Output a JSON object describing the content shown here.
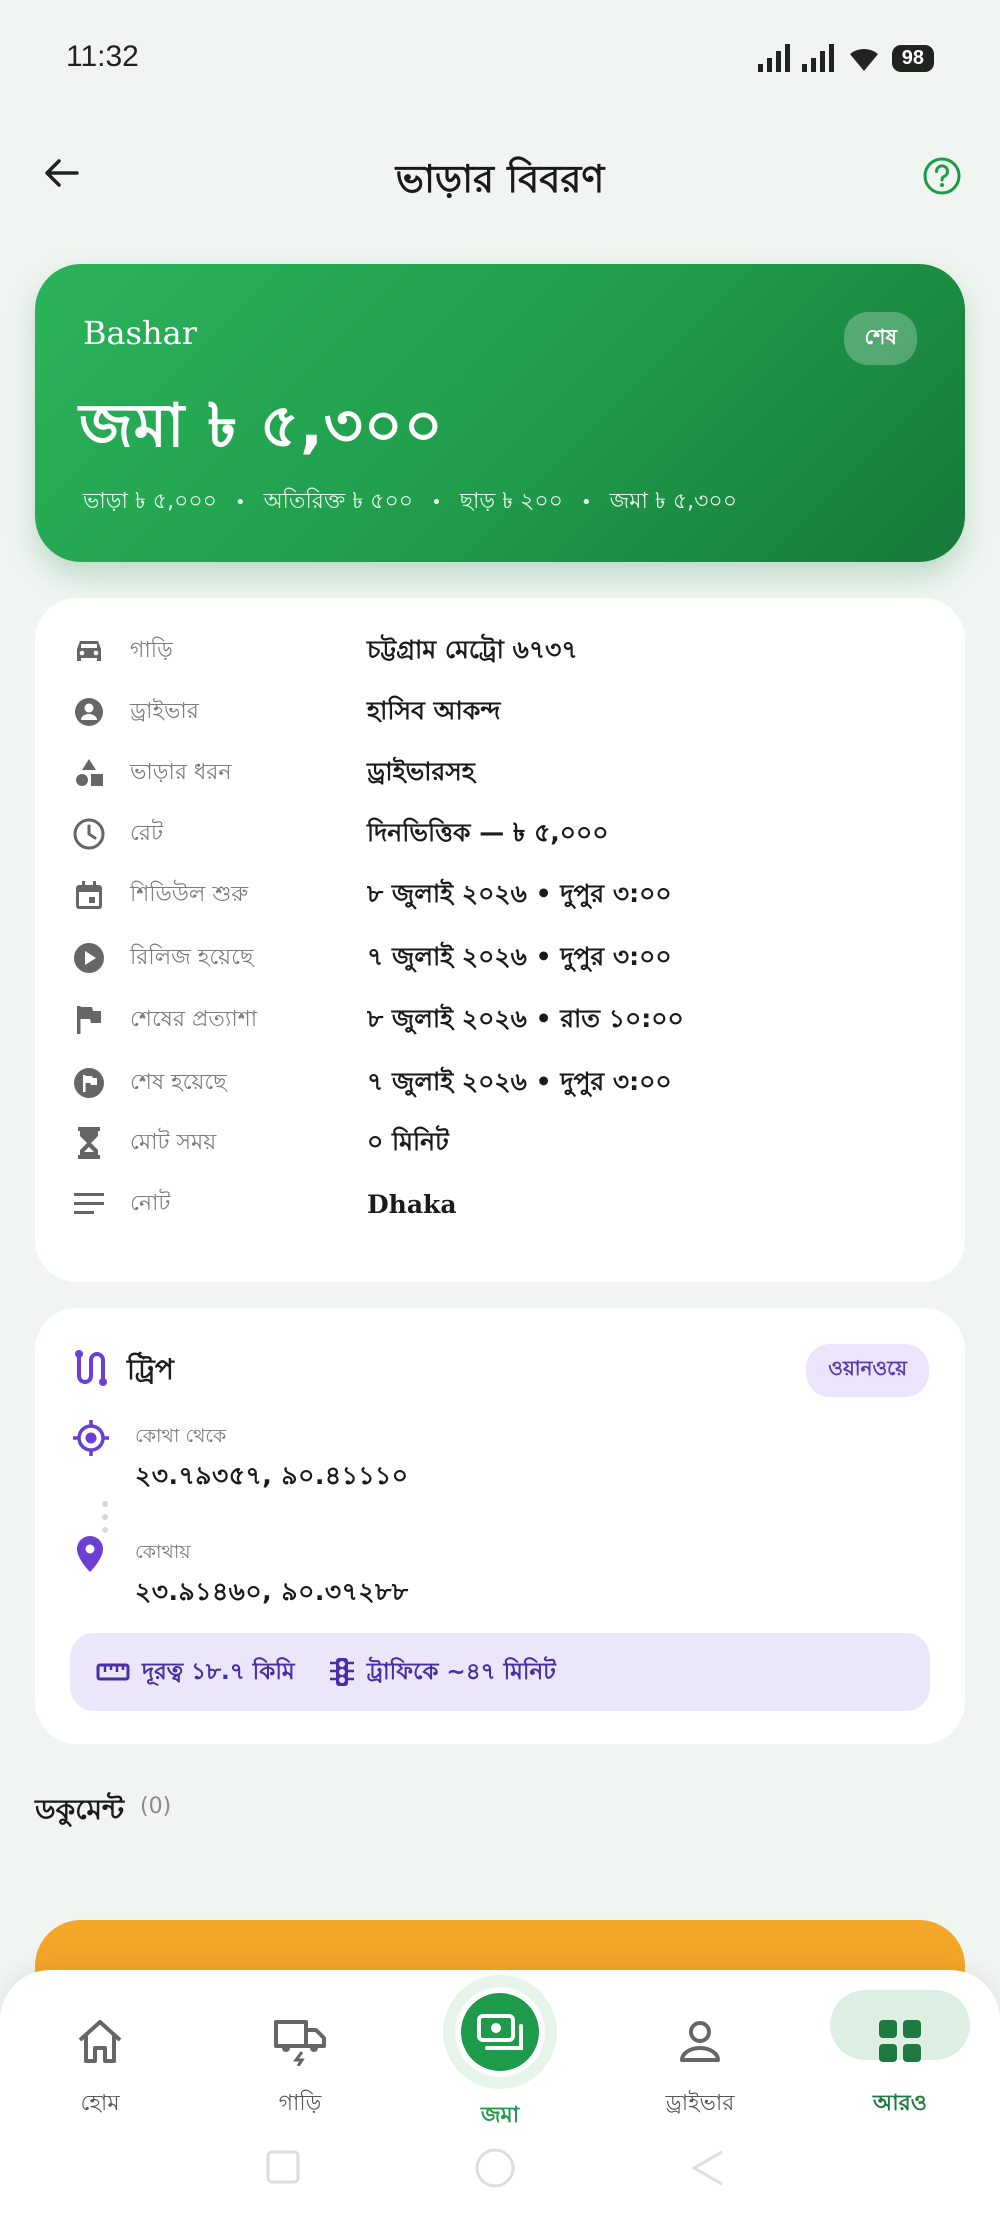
{
  "status_bar": {
    "time": "11:32",
    "battery": "98"
  },
  "header": {
    "title": "ভাড়ার বিবরণ"
  },
  "hero": {
    "name": "Bashar",
    "badge": "শেষ",
    "amount": "জমা ৳ ৫,৩০০",
    "breakdown": [
      "ভাড়া ৳ ৫,০০০",
      "অতিরিক্ত ৳ ৫০০",
      "ছাড় ৳ ২০০",
      "জমা ৳ ৫,৩০০"
    ],
    "separator": "•"
  },
  "details": [
    {
      "icon": "car-icon",
      "label": "গাড়ি",
      "value": "চট্টগ্রাম মেট্রো ৬৭৩৭"
    },
    {
      "icon": "driver-icon",
      "label": "ড্রাইভার",
      "value": "হাসিব আকন্দ"
    },
    {
      "icon": "shapes-icon",
      "label": "ভাড়ার ধরন",
      "value": "ড্রাইভারসহ"
    },
    {
      "icon": "clock-icon",
      "label": "রেট",
      "value": "দিনভিত্তিক — ৳ ৫,০০০"
    },
    {
      "icon": "calendar-icon",
      "label": "শিডিউল শুরু",
      "value": "৮ জুলাই ২০২৬ • দুপুর ৩:০০"
    },
    {
      "icon": "play-icon",
      "label": "রিলিজ হয়েছে",
      "value": "৭ জুলাই ২০২৬ • দুপুর ৩:০০"
    },
    {
      "icon": "flag-icon",
      "label": "শেষের প্রত্যাশা",
      "value": "৮ জুলাই ২০২৬ • রাত ১০:০০"
    },
    {
      "icon": "flag-circle-icon",
      "label": "শেষ হয়েছে",
      "value": "৭ জুলাই ২০২৬ • দুপুর ৩:০০"
    },
    {
      "icon": "hourglass-icon",
      "label": "মোট সময়",
      "value": "০ মিনিট"
    },
    {
      "icon": "notes-icon",
      "label": "নোট",
      "value": "Dhaka"
    }
  ],
  "trip": {
    "title": "ট্রিপ",
    "badge": "ওয়ানওয়ে",
    "from_label": "কোথা থেকে",
    "from_value": "২৩.৭৯৩৫৭, ৯০.৪১১১০",
    "to_label": "কোথায়",
    "to_value": "২৩.৯১৪৬০, ৯০.৩৭২৮৮",
    "distance": "দূরত্ব ১৮.৭ কিমি",
    "traffic": "ট্রাফিকে ~৪৭ মিনিট"
  },
  "documents": {
    "title": "ডকুমেন্ট",
    "count": "(0)"
  },
  "bottom_nav": {
    "home": "হোম",
    "vehicles": "গাড়ি",
    "deposit": "জমা",
    "drivers": "ড্রাইভার",
    "more": "আরও"
  },
  "colors": {
    "primary": "#1e9a4b",
    "accent_purple": "#6b3fd4",
    "orange": "#f3a628"
  }
}
